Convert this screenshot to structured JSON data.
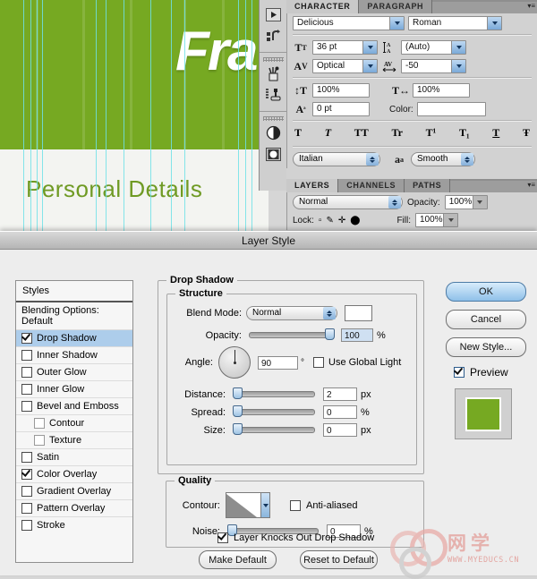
{
  "document": {
    "headline": "Fra",
    "section_title": "Personal Details",
    "green_hex": "#76a922",
    "guide_hex": "#6fe0e8"
  },
  "toolbar": {
    "items": [
      {
        "name": "play-button-icon",
        "label": "Play"
      },
      {
        "name": "undo-action-icon",
        "label": "Undo"
      },
      {
        "name": "brush-jar-icon",
        "label": "Brushes"
      },
      {
        "name": "stamp-tool-icon",
        "label": "Tool Presets"
      },
      {
        "name": "halftone-circle-icon",
        "label": "Adjustments"
      },
      {
        "name": "mask-thumbnail-icon",
        "label": "Masks"
      }
    ]
  },
  "character_panel": {
    "tabs": [
      {
        "label": "CHARACTER",
        "active": true
      },
      {
        "label": "PARAGRAPH",
        "active": false
      }
    ],
    "menu_icon": "panel-menu-icon",
    "font_family": "Delicious",
    "font_style": "Roman",
    "font_size_icon": "font-size-icon",
    "font_size": "36 pt",
    "leading_icon": "leading-icon",
    "leading": "(Auto)",
    "kerning_icon": "kerning-icon",
    "kerning": "Optical",
    "tracking_icon": "tracking-icon",
    "tracking": "-50",
    "vertical_scale_icon": "vertical-scale-icon",
    "vertical_scale": "100%",
    "horizontal_scale_icon": "horizontal-scale-icon",
    "horizontal_scale": "100%",
    "baseline_icon": "baseline-shift-icon",
    "baseline_shift": "0 pt",
    "color_label": "Color:",
    "color_value": "#ffffff",
    "style_buttons": [
      {
        "name": "faux-bold-button",
        "glyph": "T"
      },
      {
        "name": "faux-italic-button",
        "glyph": "T"
      },
      {
        "name": "all-caps-button",
        "glyph": "TT"
      },
      {
        "name": "small-caps-button",
        "glyph": "Tr"
      },
      {
        "name": "superscript-button",
        "glyph": "T¹"
      },
      {
        "name": "subscript-button",
        "glyph": "T₁"
      },
      {
        "name": "underline-button",
        "glyph": "T"
      },
      {
        "name": "strikethrough-button",
        "glyph": "Ŧ"
      }
    ],
    "language": "Italian",
    "aa_icon": "anti-alias-icon",
    "anti_alias": "Smooth"
  },
  "layers_panel": {
    "tabs": [
      {
        "label": "LAYERS",
        "active": true
      },
      {
        "label": "CHANNELS",
        "active": false
      },
      {
        "label": "PATHS",
        "active": false
      }
    ],
    "menu_icon": "panel-menu-icon",
    "blend_mode": "Normal",
    "opacity_label": "Opacity:",
    "opacity_value": "100%",
    "lock_label": "Lock:",
    "fill_label": "Fill:",
    "fill_value": "100%"
  },
  "layer_style": {
    "title": "Layer Style",
    "styles_header": "Styles",
    "styles": [
      {
        "label": "Blending Options: Default",
        "checkbox": false,
        "checked": false,
        "sub": false,
        "selected": false
      },
      {
        "label": "Drop Shadow",
        "checkbox": true,
        "checked": true,
        "sub": false,
        "selected": true
      },
      {
        "label": "Inner Shadow",
        "checkbox": true,
        "checked": false,
        "sub": false,
        "selected": false
      },
      {
        "label": "Outer Glow",
        "checkbox": true,
        "checked": false,
        "sub": false,
        "selected": false
      },
      {
        "label": "Inner Glow",
        "checkbox": true,
        "checked": false,
        "sub": false,
        "selected": false
      },
      {
        "label": "Bevel and Emboss",
        "checkbox": true,
        "checked": false,
        "sub": false,
        "selected": false
      },
      {
        "label": "Contour",
        "checkbox": true,
        "checked": false,
        "sub": true,
        "selected": false
      },
      {
        "label": "Texture",
        "checkbox": true,
        "checked": false,
        "sub": true,
        "selected": false
      },
      {
        "label": "Satin",
        "checkbox": true,
        "checked": false,
        "sub": false,
        "selected": false
      },
      {
        "label": "Color Overlay",
        "checkbox": true,
        "checked": true,
        "sub": false,
        "selected": false
      },
      {
        "label": "Gradient Overlay",
        "checkbox": true,
        "checked": false,
        "sub": false,
        "selected": false
      },
      {
        "label": "Pattern Overlay",
        "checkbox": true,
        "checked": false,
        "sub": false,
        "selected": false
      },
      {
        "label": "Stroke",
        "checkbox": true,
        "checked": false,
        "sub": false,
        "selected": false
      }
    ],
    "drop_shadow_legend": "Drop Shadow",
    "structure_legend": "Structure",
    "blend_mode_label": "Blend Mode:",
    "blend_mode_value": "Normal",
    "shadow_color": "#ffffff",
    "opacity_label": "Opacity:",
    "opacity_value": "100",
    "opacity_unit": "%",
    "angle_label": "Angle:",
    "angle_value": "90",
    "angle_unit": "°",
    "use_global_light": "Use Global Light",
    "use_global_light_checked": false,
    "distance_label": "Distance:",
    "distance_value": "2",
    "distance_unit": "px",
    "spread_label": "Spread:",
    "spread_value": "0",
    "spread_unit": "%",
    "size_label": "Size:",
    "size_value": "0",
    "size_unit": "px",
    "quality_legend": "Quality",
    "contour_label": "Contour:",
    "anti_aliased_label": "Anti-aliased",
    "anti_aliased_checked": false,
    "noise_label": "Noise:",
    "noise_value": "0",
    "noise_unit": "%",
    "knockout_label": "Layer Knocks Out Drop Shadow",
    "knockout_checked": true,
    "make_default": "Make Default",
    "reset_default": "Reset to Default",
    "ok": "OK",
    "cancel": "Cancel",
    "new_style": "New Style...",
    "preview_label": "Preview",
    "preview_checked": true,
    "preview_color": "#76a922"
  },
  "watermark": {
    "cn_text": "网学",
    "url": "WWW.MYEDUCS.CN"
  }
}
